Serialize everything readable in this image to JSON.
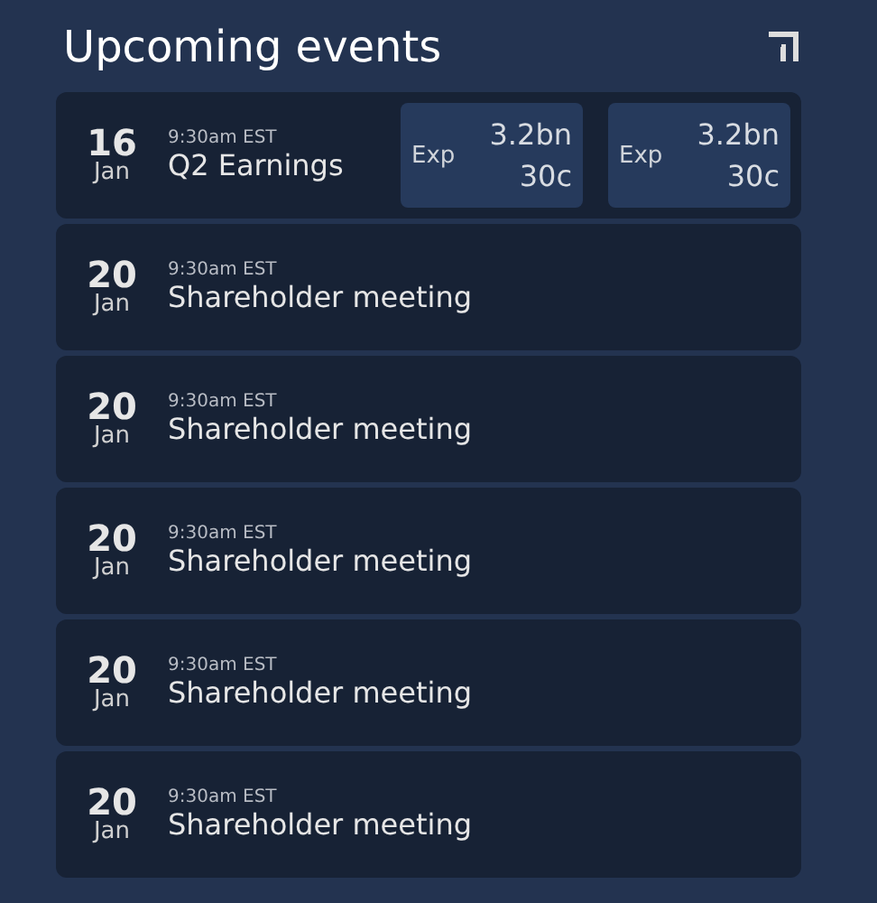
{
  "title": "Upcoming events",
  "events": [
    {
      "day": "16",
      "month": "Jan",
      "time": "9:30am EST",
      "name": "Q2 Earnings",
      "stats": [
        {
          "label": "Exp",
          "values": [
            "3.2bn",
            "30c"
          ]
        },
        {
          "label": "Exp",
          "values": [
            "3.2bn",
            "30c"
          ]
        }
      ]
    },
    {
      "day": "20",
      "month": "Jan",
      "time": "9:30am EST",
      "name": "Shareholder meeting"
    },
    {
      "day": "20",
      "month": "Jan",
      "time": "9:30am EST",
      "name": "Shareholder meeting"
    },
    {
      "day": "20",
      "month": "Jan",
      "time": "9:30am EST",
      "name": "Shareholder meeting"
    },
    {
      "day": "20",
      "month": "Jan",
      "time": "9:30am EST",
      "name": "Shareholder meeting"
    },
    {
      "day": "20",
      "month": "Jan",
      "time": "9:30am EST",
      "name": "Shareholder meeting"
    }
  ]
}
